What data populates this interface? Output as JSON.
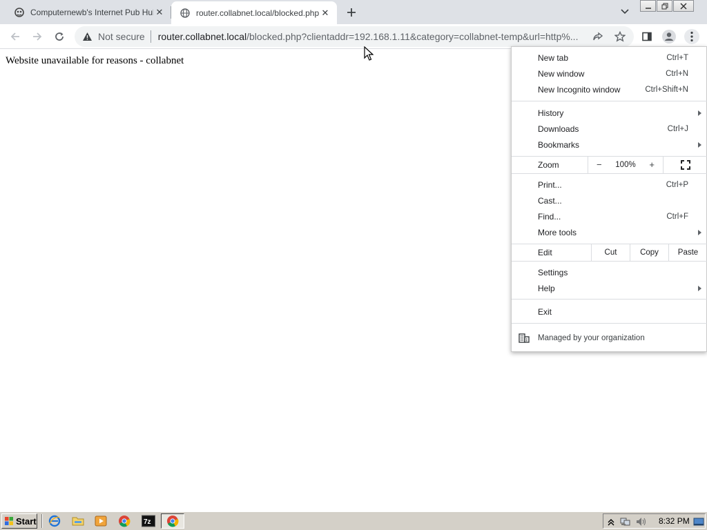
{
  "tabs": [
    {
      "title": "Computernewb's Internet Pub Hub",
      "favicon": "computernewb-icon",
      "active": false
    },
    {
      "title": "router.collabnet.local/blocked.php?c",
      "favicon": "globe-icon",
      "active": true
    }
  ],
  "omnibox": {
    "security_label": "Not secure",
    "url_host": "router.collabnet.local",
    "url_rest": "/blocked.php?clientaddr=192.168.1.11&category=collabnet-temp&url=http%..."
  },
  "page": {
    "message": "Website unavailable for reasons - collabnet"
  },
  "menu": {
    "items": [
      {
        "label": "New tab",
        "shortcut": "Ctrl+T"
      },
      {
        "label": "New window",
        "shortcut": "Ctrl+N"
      },
      {
        "label": "New Incognito window",
        "shortcut": "Ctrl+Shift+N"
      },
      {
        "label": "History",
        "shortcut": ""
      },
      {
        "label": "Downloads",
        "shortcut": "Ctrl+J"
      },
      {
        "label": "Bookmarks",
        "shortcut": ""
      },
      {
        "label": "Print...",
        "shortcut": "Ctrl+P"
      },
      {
        "label": "Cast...",
        "shortcut": ""
      },
      {
        "label": "Find...",
        "shortcut": "Ctrl+F"
      },
      {
        "label": "More tools",
        "shortcut": ""
      },
      {
        "label": "Settings",
        "shortcut": ""
      },
      {
        "label": "Help",
        "shortcut": ""
      },
      {
        "label": "Exit",
        "shortcut": ""
      }
    ],
    "zoom": {
      "label": "Zoom",
      "minus": "−",
      "value": "100%",
      "plus": "+"
    },
    "edit": {
      "label": "Edit",
      "cut": "Cut",
      "copy": "Copy",
      "paste": "Paste"
    },
    "managed": "Managed by your organization"
  },
  "taskbar": {
    "start_label": "Start",
    "clock": "8:32 PM"
  },
  "colors": {
    "tabstrip_bg": "#dee1e6",
    "omnibox_bg": "#f1f3f4",
    "taskbar_bg": "#d4d0c8"
  }
}
